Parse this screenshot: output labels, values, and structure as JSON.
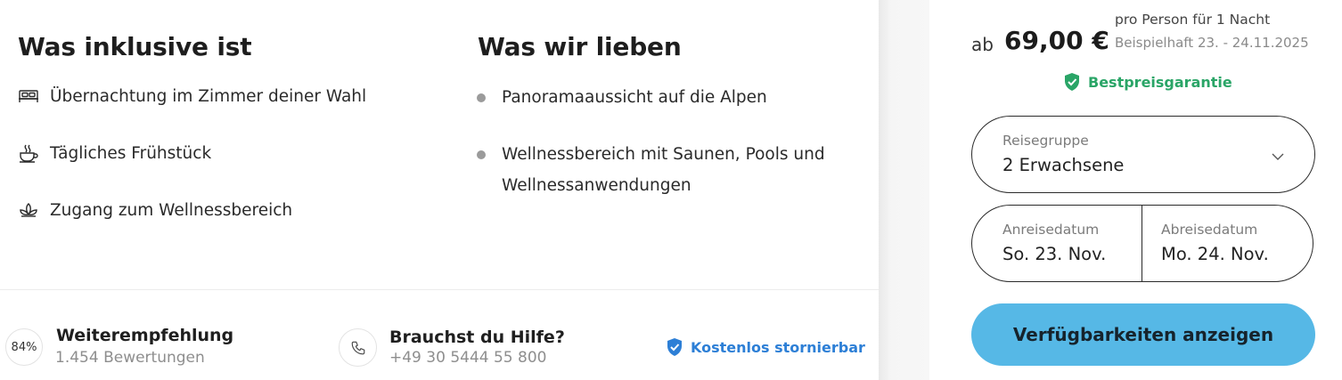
{
  "included": {
    "title": "Was inklusive ist",
    "items": [
      {
        "label": "Übernachtung im Zimmer deiner Wahl",
        "icon": "bed-icon"
      },
      {
        "label": "Tägliches Frühstück",
        "icon": "coffee-cup-icon"
      },
      {
        "label": "Zugang zum Wellnessbereich",
        "icon": "lotus-icon"
      }
    ]
  },
  "loved": {
    "title": "Was wir lieben",
    "items": [
      {
        "line1": "Panoramaaussicht auf die Alpen",
        "line2": ""
      },
      {
        "line1": "Wellnessbereich mit Saunen, Pools und",
        "line2": "Wellnessanwendungen"
      }
    ]
  },
  "footer": {
    "recommend": {
      "badge": "84%",
      "title": "Weiterempfehlung",
      "sub": "1.454 Bewertungen"
    },
    "help": {
      "title": "Brauchst du Hilfe?",
      "phone": "+49 30 5444 55 800",
      "icon": "phone-icon"
    },
    "free_cancel": {
      "label": "Kostenlos stornierbar",
      "icon": "shield-check-icon"
    }
  },
  "booking": {
    "price_prefix": "ab",
    "price": "69,00 €",
    "price_note": "pro Person für 1 Nacht",
    "example_dates": "Beispielhaft 23. - 24.11.2025",
    "best_price": "Bestpreisgarantie",
    "travel_group": {
      "label": "Reisegruppe",
      "value": "2 Erwachsene"
    },
    "arrival": {
      "label": "Anreisedatum",
      "value": "So. 23. Nov."
    },
    "departure": {
      "label": "Abreisedatum",
      "value": "Mo. 24. Nov."
    },
    "cta": "Verfügbarkeiten anzeigen"
  },
  "colors": {
    "cta_bg": "#56b8e6",
    "best_price_green": "#2aa567",
    "free_cancel_blue": "#2d7fd6",
    "bullet_gray": "#9b9b9b"
  }
}
